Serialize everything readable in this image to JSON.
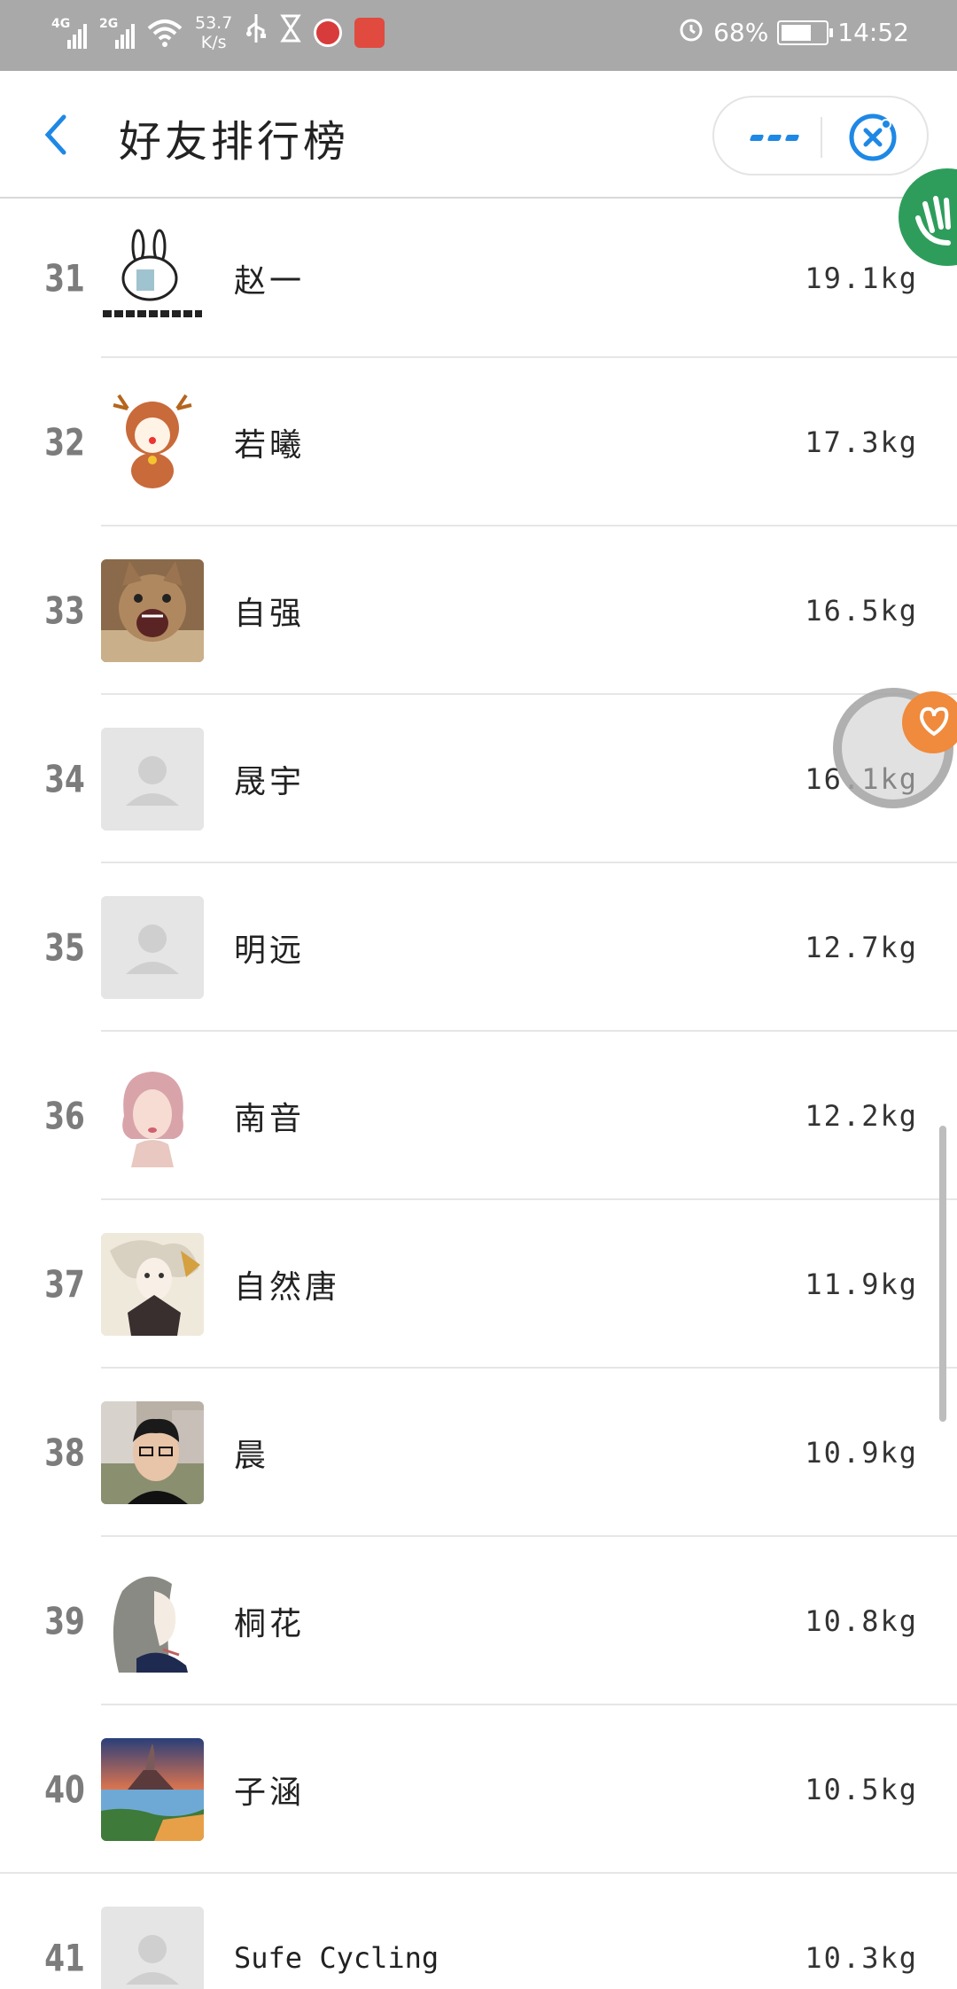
{
  "status_bar": {
    "signal1_label": "4G",
    "signal2_label": "2G",
    "net_speed_value": "53.7",
    "net_speed_unit": "K/s",
    "battery": "68%",
    "time": "14:52"
  },
  "header": {
    "title": "好友排行榜"
  },
  "icons": {
    "back": "chevron-left-icon",
    "more": "more-dots-icon",
    "close": "close-circle-icon",
    "alarm": "alarm-icon",
    "usb": "usb-icon",
    "hourglass": "hourglass-icon"
  },
  "colors": {
    "accent": "#1e88e5",
    "status_bar": "#a9a9a9",
    "divider": "#e6e6e6",
    "rank": "#7c7c7c"
  },
  "ranking": [
    {
      "rank": "31",
      "name": "赵一",
      "weight": "19.1kg",
      "avatar": "rabbit-sticker"
    },
    {
      "rank": "32",
      "name": "若曦",
      "weight": "17.3kg",
      "avatar": "reindeer-cartoon"
    },
    {
      "rank": "33",
      "name": "自强",
      "weight": "16.5kg",
      "avatar": "cat-photo"
    },
    {
      "rank": "34",
      "name": "晟宇",
      "weight": "16.1kg",
      "avatar": "default"
    },
    {
      "rank": "35",
      "name": "明远",
      "weight": "12.7kg",
      "avatar": "default"
    },
    {
      "rank": "36",
      "name": "南音",
      "weight": "12.2kg",
      "avatar": "pink-hair-girl"
    },
    {
      "rank": "37",
      "name": "自然唐",
      "weight": "11.9kg",
      "avatar": "anime-drawing"
    },
    {
      "rank": "38",
      "name": "晨",
      "weight": "10.9kg",
      "avatar": "selfie-photo"
    },
    {
      "rank": "39",
      "name": "桐花",
      "weight": "10.8kg",
      "avatar": "sketch-girl"
    },
    {
      "rank": "40",
      "name": "子涵",
      "weight": "10.5kg",
      "avatar": "volcano-photo"
    },
    {
      "rank": "41",
      "name": "Sufe Cycling",
      "weight": "10.3kg",
      "avatar": "default"
    }
  ]
}
